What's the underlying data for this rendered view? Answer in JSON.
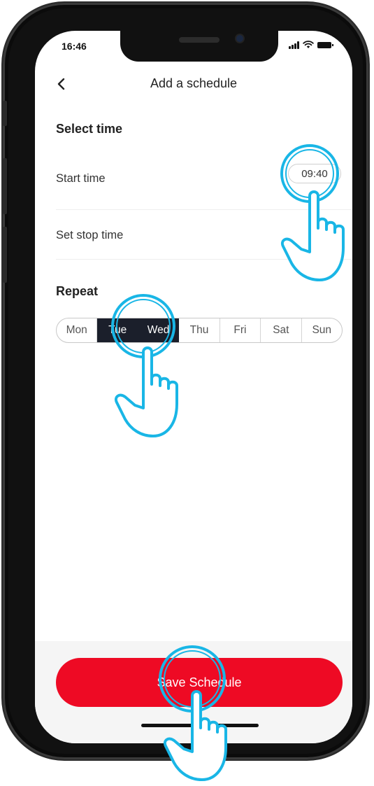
{
  "status_bar": {
    "time": "16:46"
  },
  "nav": {
    "title": "Add a schedule",
    "back_icon": "chevron-left-icon"
  },
  "select_time": {
    "title": "Select time",
    "start_time_label": "Start time",
    "start_time_value": "09:40",
    "stop_time_label": "Set stop time",
    "stop_time_enabled": false
  },
  "repeat": {
    "title": "Repeat",
    "days": [
      {
        "label": "Mon",
        "selected": false
      },
      {
        "label": "Tue",
        "selected": true
      },
      {
        "label": "Wed",
        "selected": true
      },
      {
        "label": "Thu",
        "selected": false
      },
      {
        "label": "Fri",
        "selected": false
      },
      {
        "label": "Sat",
        "selected": false
      },
      {
        "label": "Sun",
        "selected": false
      }
    ]
  },
  "footer": {
    "save_label": "Save Schedule"
  },
  "colors": {
    "accent": "#ee0a24",
    "selected_day": "#1b1f2b",
    "hint": "#19b6e6"
  }
}
